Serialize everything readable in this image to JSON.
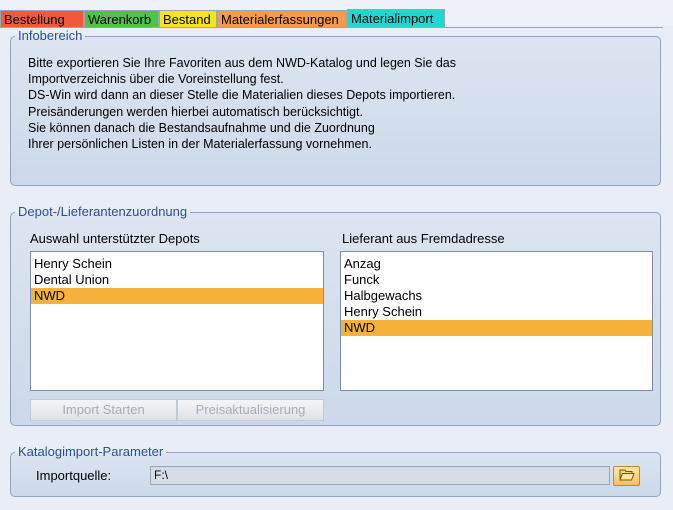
{
  "tabs": [
    {
      "label": "Bestellung",
      "color": "#f05a3c"
    },
    {
      "label": "Warenkorb",
      "color": "#4fc24a"
    },
    {
      "label": "Bestand",
      "color": "#f6e51a"
    },
    {
      "label": "Materialerfassungen",
      "color": "#f59a47"
    },
    {
      "label": "Materialimport",
      "color": "#22d7cf",
      "active": true
    }
  ],
  "info": {
    "title": "Infobereich",
    "lines": [
      "Bitte exportieren Sie Ihre Favoriten aus dem NWD-Katalog und legen Sie das",
      "Importverzeichnis über die Voreinstellung fest.",
      "DS-Win wird dann an dieser Stelle die Materialien dieses Depots importieren.",
      "Preisänderungen werden hierbei automatisch berücksichtigt.",
      "Sie können danach die Bestandsaufnahme und die Zuordnung",
      "Ihrer persönlichen Listen in der Materialerfassung vornehmen."
    ]
  },
  "depot": {
    "title": "Depot-/Lieferantenzuordnung",
    "depots_label": "Auswahl unterstützter Depots",
    "depots": [
      "Henry Schein",
      "Dental Union",
      "NWD"
    ],
    "depots_selected": "NWD",
    "supplier_label": "Lieferant aus Fremdadresse",
    "suppliers": [
      "Anzag",
      "Funck",
      "Halbgewachs",
      "Henry Schein",
      "NWD"
    ],
    "suppliers_selected": "NWD",
    "import_button": "Import Starten",
    "price_button": "Preisaktualisierung"
  },
  "catalog": {
    "title": "Katalogimport-Parameter",
    "source_label": "Importquelle:",
    "source_value": "F:\\",
    "browse_icon": "folder-open-icon"
  },
  "colors": {
    "selection": "#f6b23a",
    "group_title": "#2b4f93"
  }
}
